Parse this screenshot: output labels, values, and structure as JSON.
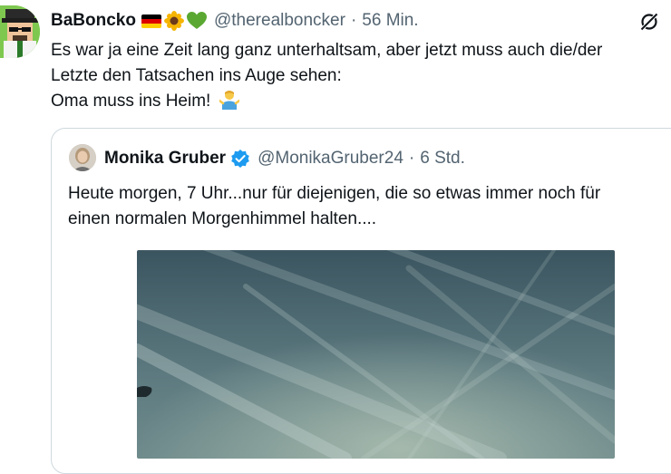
{
  "tweet": {
    "author_name": "BaBoncko",
    "handle": "@therealboncker",
    "separator": "·",
    "time": "56 Min.",
    "flag_icons": [
      "germany-flag-icon",
      "sunflower-icon",
      "green-heart-icon"
    ],
    "text_lines": [
      "Es war ja eine Zeit lang ganz unterhaltsam, aber jetzt muss auch die/der",
      "Letzte den Tatsachen ins Auge sehen:",
      "Oma muss ins Heim!"
    ],
    "emoji_icon": "person-shrugging-icon"
  },
  "quote": {
    "author_name": "Monika Gruber",
    "handle": "@MonikaGruber24",
    "separator": "·",
    "time": "6 Std.",
    "text_lines": [
      "Heute morgen, 7 Uhr...nur für diejenigen, die so etwas immer noch für",
      "einen normalen Morgenhimmel halten...."
    ]
  },
  "colors": {
    "text": "#0f1419",
    "secondary": "#536471",
    "border": "#cfd9de",
    "verified": "#1d9bf0",
    "sky": "#3d5a64"
  }
}
